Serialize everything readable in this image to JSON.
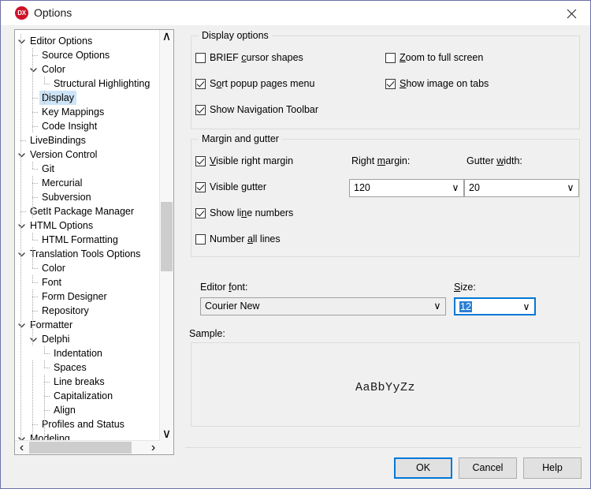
{
  "window": {
    "title": "Options",
    "icon": "devexpress-dx-icon",
    "icon_text": "DX",
    "close_label": "close-icon",
    "accent_color": "#0078d7",
    "icon_color": "#cf1126",
    "selection_color": "#cce4f7"
  },
  "tree": {
    "selected": "Display",
    "scrollbar": {
      "up_arrow": "∧",
      "down_arrow": "∨",
      "left_arrow": "‹",
      "right_arrow": "›"
    },
    "nodes": [
      {
        "label": "Editor Options",
        "depth": 0,
        "expander": "expanded",
        "selected": false
      },
      {
        "label": "Source Options",
        "depth": 1,
        "expander": "leaf",
        "selected": false
      },
      {
        "label": "Color",
        "depth": 1,
        "expander": "expanded",
        "selected": false
      },
      {
        "label": "Structural Highlighting",
        "depth": 2,
        "expander": "leaf",
        "selected": false
      },
      {
        "label": "Display",
        "depth": 1,
        "expander": "leaf",
        "selected": true
      },
      {
        "label": "Key Mappings",
        "depth": 1,
        "expander": "leaf",
        "selected": false
      },
      {
        "label": "Code Insight",
        "depth": 1,
        "expander": "leaf",
        "selected": false
      },
      {
        "label": "LiveBindings",
        "depth": 0,
        "expander": "leaf",
        "selected": false
      },
      {
        "label": "Version Control",
        "depth": 0,
        "expander": "expanded",
        "selected": false
      },
      {
        "label": "Git",
        "depth": 1,
        "expander": "leaf",
        "selected": false
      },
      {
        "label": "Mercurial",
        "depth": 1,
        "expander": "leaf",
        "selected": false
      },
      {
        "label": "Subversion",
        "depth": 1,
        "expander": "leaf",
        "selected": false
      },
      {
        "label": "GetIt Package Manager",
        "depth": 0,
        "expander": "leaf",
        "selected": false
      },
      {
        "label": "HTML Options",
        "depth": 0,
        "expander": "expanded",
        "selected": false
      },
      {
        "label": "HTML Formatting",
        "depth": 1,
        "expander": "leaf",
        "selected": false
      },
      {
        "label": "Translation Tools Options",
        "depth": 0,
        "expander": "expanded",
        "selected": false
      },
      {
        "label": "Color",
        "depth": 1,
        "expander": "leaf",
        "selected": false
      },
      {
        "label": "Font",
        "depth": 1,
        "expander": "leaf",
        "selected": false
      },
      {
        "label": "Form Designer",
        "depth": 1,
        "expander": "leaf",
        "selected": false
      },
      {
        "label": "Repository",
        "depth": 1,
        "expander": "leaf",
        "selected": false
      },
      {
        "label": "Formatter",
        "depth": 0,
        "expander": "expanded",
        "selected": false
      },
      {
        "label": "Delphi",
        "depth": 1,
        "expander": "expanded",
        "selected": false
      },
      {
        "label": "Indentation",
        "depth": 2,
        "expander": "leaf",
        "selected": false
      },
      {
        "label": "Spaces",
        "depth": 2,
        "expander": "leaf",
        "selected": false
      },
      {
        "label": "Line breaks",
        "depth": 2,
        "expander": "leaf",
        "selected": false
      },
      {
        "label": "Capitalization",
        "depth": 2,
        "expander": "leaf",
        "selected": false
      },
      {
        "label": "Align",
        "depth": 2,
        "expander": "leaf",
        "selected": false
      },
      {
        "label": "Profiles and Status",
        "depth": 1,
        "expander": "leaf",
        "selected": false
      },
      {
        "label": "Modeling",
        "depth": 0,
        "expander": "expanded",
        "selected": false
      }
    ]
  },
  "display_options": {
    "group_title": "Display options",
    "checkboxes": [
      {
        "label": "BRIEF cursor shapes",
        "accel": "c",
        "checked": false,
        "col": 0,
        "row": 0
      },
      {
        "label": "Sort popup pages menu",
        "accel": "o",
        "checked": true,
        "col": 0,
        "row": 1
      },
      {
        "label": "Show Navigation Toolbar",
        "accel": "",
        "checked": true,
        "col": 0,
        "row": 2
      },
      {
        "label": "Zoom to full screen",
        "accel": "Z",
        "checked": false,
        "col": 1,
        "row": 0
      },
      {
        "label": "Show image on tabs",
        "accel": "S",
        "checked": true,
        "col": 1,
        "row": 1
      }
    ]
  },
  "margin_gutter": {
    "group_title": "Margin and gutter",
    "checkboxes": [
      {
        "label": "Visible right margin",
        "accel": "V",
        "checked": true
      },
      {
        "label": "Visible gutter",
        "accel": "g",
        "checked": true
      },
      {
        "label": "Show line numbers",
        "accel": "n",
        "checked": true
      },
      {
        "label": "Number all lines",
        "accel": "a",
        "checked": false
      }
    ],
    "right_margin_label": "Right margin:",
    "right_margin_accel": "m",
    "right_margin_value": "120",
    "gutter_width_label": "Gutter width:",
    "gutter_width_accel": "w",
    "gutter_width_value": "20",
    "dropdown_arrow": "∨"
  },
  "font_section": {
    "editor_font_label": "Editor font:",
    "editor_font_accel": "f",
    "editor_font_value": "Courier New",
    "size_label": "Size:",
    "size_accel": "S",
    "size_value": "12",
    "size_selected": true,
    "sample_label": "Sample:",
    "sample_text": "AaBbYyZz",
    "dropdown_arrow": "∨"
  },
  "footer": {
    "ok_label": "OK",
    "cancel_label": "Cancel",
    "help_label": "Help",
    "default_button": "OK"
  }
}
